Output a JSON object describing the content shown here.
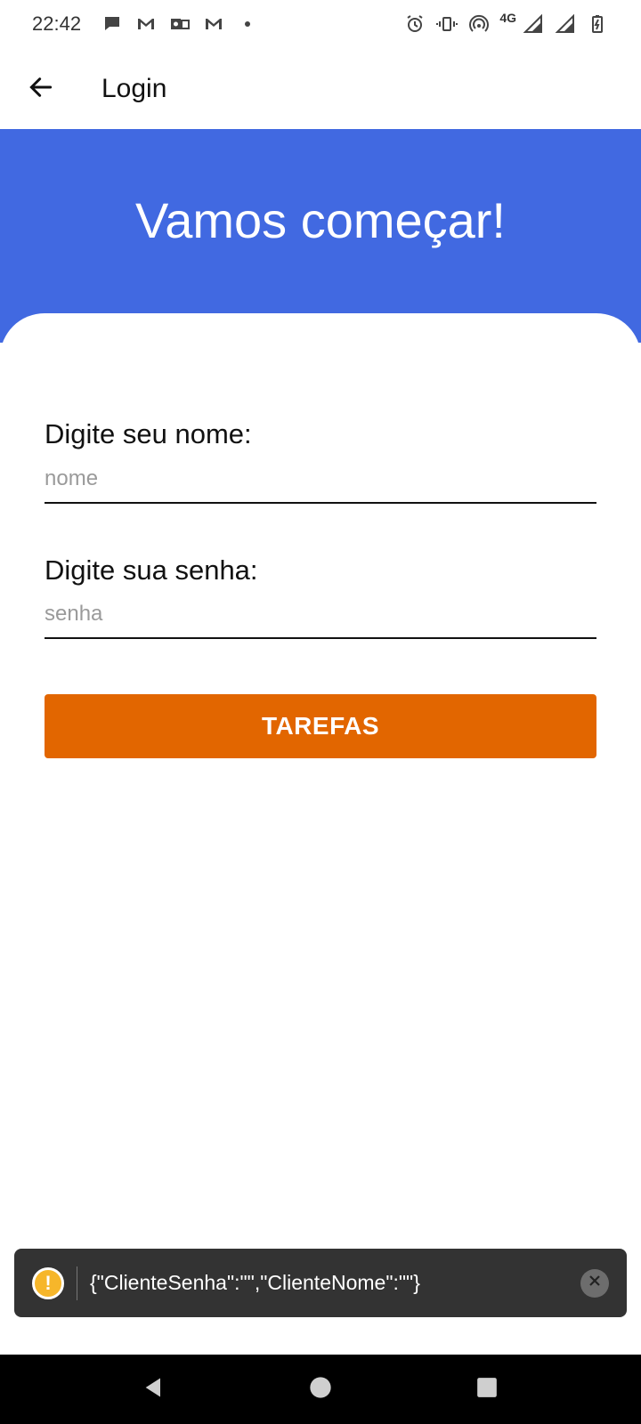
{
  "status_bar": {
    "time": "22:42",
    "network": "4G",
    "left_icons": [
      "chat-icon",
      "gmail-icon",
      "outlook-icon",
      "gmail-icon",
      "dot-icon"
    ],
    "right_icons": [
      "alarm-icon",
      "vibrate-icon",
      "hotspot-icon",
      "signal-icon",
      "signal-icon",
      "battery-charging-icon"
    ]
  },
  "app_bar": {
    "title": "Login",
    "back_icon": "arrow-left-icon"
  },
  "hero": {
    "title": "Vamos começar!",
    "color": "#4169e1"
  },
  "form": {
    "name_label": "Digite seu nome:",
    "name_value": "",
    "name_placeholder": "nome",
    "password_label": "Digite sua senha:",
    "password_value": "",
    "password_placeholder": "senha",
    "submit_label": "TAREFAS",
    "submit_color": "#e26600"
  },
  "toast": {
    "icon": "warning-icon",
    "message": "{\"ClienteSenha\":\"\",\"ClienteNome\":\"\"}",
    "close_icon": "close-icon"
  },
  "nav_bar": {
    "buttons": [
      "back-triangle-icon",
      "home-circle-icon",
      "recents-square-icon"
    ]
  }
}
